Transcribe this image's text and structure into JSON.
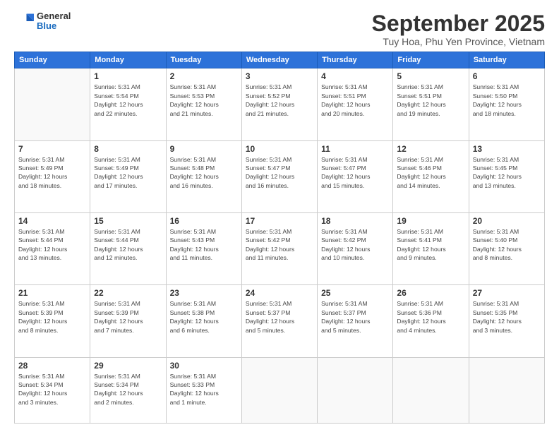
{
  "header": {
    "logo_general": "General",
    "logo_blue": "Blue",
    "month_title": "September 2025",
    "subtitle": "Tuy Hoa, Phu Yen Province, Vietnam"
  },
  "weekdays": [
    "Sunday",
    "Monday",
    "Tuesday",
    "Wednesday",
    "Thursday",
    "Friday",
    "Saturday"
  ],
  "weeks": [
    [
      {
        "day": "",
        "info": ""
      },
      {
        "day": "1",
        "info": "Sunrise: 5:31 AM\nSunset: 5:54 PM\nDaylight: 12 hours\nand 22 minutes."
      },
      {
        "day": "2",
        "info": "Sunrise: 5:31 AM\nSunset: 5:53 PM\nDaylight: 12 hours\nand 21 minutes."
      },
      {
        "day": "3",
        "info": "Sunrise: 5:31 AM\nSunset: 5:52 PM\nDaylight: 12 hours\nand 21 minutes."
      },
      {
        "day": "4",
        "info": "Sunrise: 5:31 AM\nSunset: 5:51 PM\nDaylight: 12 hours\nand 20 minutes."
      },
      {
        "day": "5",
        "info": "Sunrise: 5:31 AM\nSunset: 5:51 PM\nDaylight: 12 hours\nand 19 minutes."
      },
      {
        "day": "6",
        "info": "Sunrise: 5:31 AM\nSunset: 5:50 PM\nDaylight: 12 hours\nand 18 minutes."
      }
    ],
    [
      {
        "day": "7",
        "info": "Sunrise: 5:31 AM\nSunset: 5:49 PM\nDaylight: 12 hours\nand 18 minutes."
      },
      {
        "day": "8",
        "info": "Sunrise: 5:31 AM\nSunset: 5:49 PM\nDaylight: 12 hours\nand 17 minutes."
      },
      {
        "day": "9",
        "info": "Sunrise: 5:31 AM\nSunset: 5:48 PM\nDaylight: 12 hours\nand 16 minutes."
      },
      {
        "day": "10",
        "info": "Sunrise: 5:31 AM\nSunset: 5:47 PM\nDaylight: 12 hours\nand 16 minutes."
      },
      {
        "day": "11",
        "info": "Sunrise: 5:31 AM\nSunset: 5:47 PM\nDaylight: 12 hours\nand 15 minutes."
      },
      {
        "day": "12",
        "info": "Sunrise: 5:31 AM\nSunset: 5:46 PM\nDaylight: 12 hours\nand 14 minutes."
      },
      {
        "day": "13",
        "info": "Sunrise: 5:31 AM\nSunset: 5:45 PM\nDaylight: 12 hours\nand 13 minutes."
      }
    ],
    [
      {
        "day": "14",
        "info": "Sunrise: 5:31 AM\nSunset: 5:44 PM\nDaylight: 12 hours\nand 13 minutes."
      },
      {
        "day": "15",
        "info": "Sunrise: 5:31 AM\nSunset: 5:44 PM\nDaylight: 12 hours\nand 12 minutes."
      },
      {
        "day": "16",
        "info": "Sunrise: 5:31 AM\nSunset: 5:43 PM\nDaylight: 12 hours\nand 11 minutes."
      },
      {
        "day": "17",
        "info": "Sunrise: 5:31 AM\nSunset: 5:42 PM\nDaylight: 12 hours\nand 11 minutes."
      },
      {
        "day": "18",
        "info": "Sunrise: 5:31 AM\nSunset: 5:42 PM\nDaylight: 12 hours\nand 10 minutes."
      },
      {
        "day": "19",
        "info": "Sunrise: 5:31 AM\nSunset: 5:41 PM\nDaylight: 12 hours\nand 9 minutes."
      },
      {
        "day": "20",
        "info": "Sunrise: 5:31 AM\nSunset: 5:40 PM\nDaylight: 12 hours\nand 8 minutes."
      }
    ],
    [
      {
        "day": "21",
        "info": "Sunrise: 5:31 AM\nSunset: 5:39 PM\nDaylight: 12 hours\nand 8 minutes."
      },
      {
        "day": "22",
        "info": "Sunrise: 5:31 AM\nSunset: 5:39 PM\nDaylight: 12 hours\nand 7 minutes."
      },
      {
        "day": "23",
        "info": "Sunrise: 5:31 AM\nSunset: 5:38 PM\nDaylight: 12 hours\nand 6 minutes."
      },
      {
        "day": "24",
        "info": "Sunrise: 5:31 AM\nSunset: 5:37 PM\nDaylight: 12 hours\nand 5 minutes."
      },
      {
        "day": "25",
        "info": "Sunrise: 5:31 AM\nSunset: 5:37 PM\nDaylight: 12 hours\nand 5 minutes."
      },
      {
        "day": "26",
        "info": "Sunrise: 5:31 AM\nSunset: 5:36 PM\nDaylight: 12 hours\nand 4 minutes."
      },
      {
        "day": "27",
        "info": "Sunrise: 5:31 AM\nSunset: 5:35 PM\nDaylight: 12 hours\nand 3 minutes."
      }
    ],
    [
      {
        "day": "28",
        "info": "Sunrise: 5:31 AM\nSunset: 5:34 PM\nDaylight: 12 hours\nand 3 minutes."
      },
      {
        "day": "29",
        "info": "Sunrise: 5:31 AM\nSunset: 5:34 PM\nDaylight: 12 hours\nand 2 minutes."
      },
      {
        "day": "30",
        "info": "Sunrise: 5:31 AM\nSunset: 5:33 PM\nDaylight: 12 hours\nand 1 minute."
      },
      {
        "day": "",
        "info": ""
      },
      {
        "day": "",
        "info": ""
      },
      {
        "day": "",
        "info": ""
      },
      {
        "day": "",
        "info": ""
      }
    ]
  ]
}
